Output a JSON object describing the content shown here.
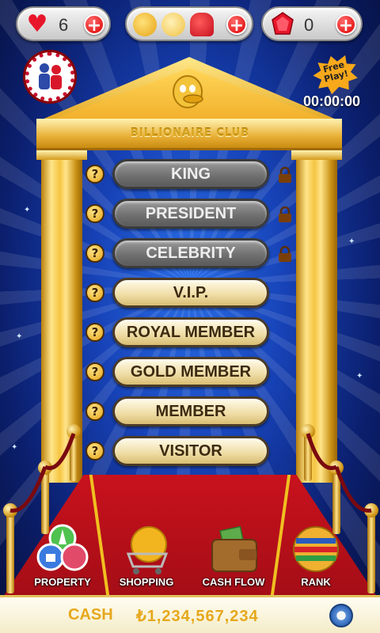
{
  "top_bar": {
    "hearts": "6",
    "gems": "0",
    "plus": "+"
  },
  "free_play": {
    "label_line1": "Free",
    "label_line2": "Play!",
    "timer": "00:00:00"
  },
  "club": {
    "title": "BILLIONAIRE CLUB"
  },
  "levels": [
    {
      "label": "KING",
      "locked": true
    },
    {
      "label": "PRESIDENT",
      "locked": true
    },
    {
      "label": "CELEBRITY",
      "locked": true
    },
    {
      "label": "V.I.P.",
      "locked": false
    },
    {
      "label": "ROYAL MEMBER",
      "locked": false
    },
    {
      "label": "GOLD MEMBER",
      "locked": false
    },
    {
      "label": "MEMBER",
      "locked": false
    },
    {
      "label": "VISITOR",
      "locked": false
    }
  ],
  "help_glyph": "?",
  "menu": {
    "property": "PROPERTY",
    "shopping": "SHOPPING",
    "cash_flow": "CASH FLOW",
    "rank": "RANK"
  },
  "cash": {
    "label": "CASH",
    "value": "₺1,234,567,234"
  },
  "colors": {
    "accent_gold": "#e6a81c",
    "background_blue": "#1743b8",
    "carpet_red": "#c8121d"
  }
}
